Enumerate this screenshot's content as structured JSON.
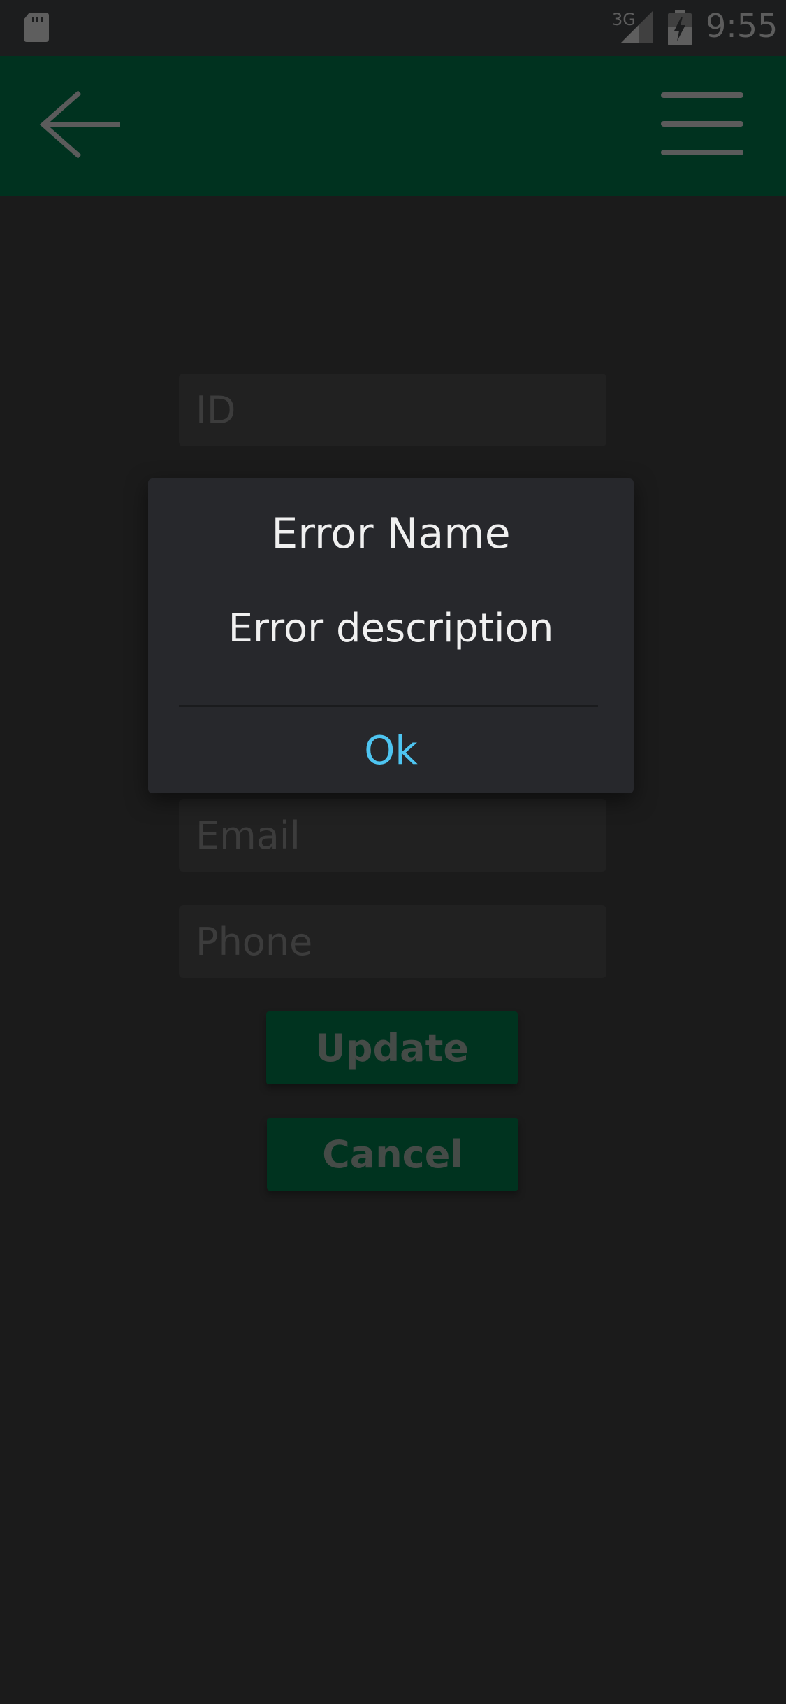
{
  "status_bar": {
    "network_type": "3G",
    "time": "9:55",
    "icons": [
      "sd-card-icon",
      "signal-icon",
      "battery-charging-icon"
    ]
  },
  "app_bar": {
    "back_icon": "arrow-left-icon",
    "menu_icon": "hamburger-menu-icon",
    "color": "#00321f"
  },
  "form": {
    "id_placeholder": "ID",
    "email_placeholder": "Email",
    "phone_placeholder": "Phone",
    "update_label": "Update",
    "cancel_label": "Cancel"
  },
  "dialog": {
    "title": "Error Name",
    "message": "Error description",
    "ok_label": "Ok",
    "ok_color": "#4ec5f1"
  }
}
